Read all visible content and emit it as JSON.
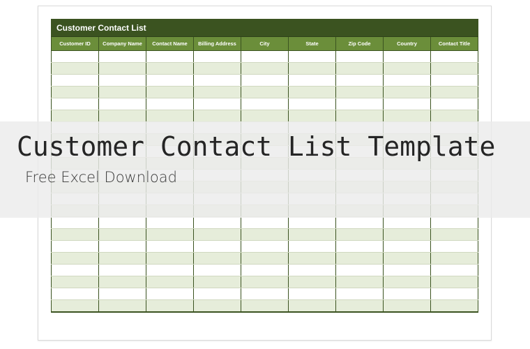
{
  "sheet": {
    "title": "Customer Contact List",
    "columns": [
      "Customer ID",
      "Company Name",
      "Contact Name",
      "Billing Address",
      "City",
      "State",
      "Zip Code",
      "Country",
      "Contact Title"
    ],
    "row_count": 22
  },
  "overlay": {
    "headline": "Customer Contact List Template",
    "subline": "Free Excel Download"
  },
  "colors": {
    "header_dark": "#3b5320",
    "header_mid": "#6b8e3a",
    "row_alt": "#e6edda"
  }
}
